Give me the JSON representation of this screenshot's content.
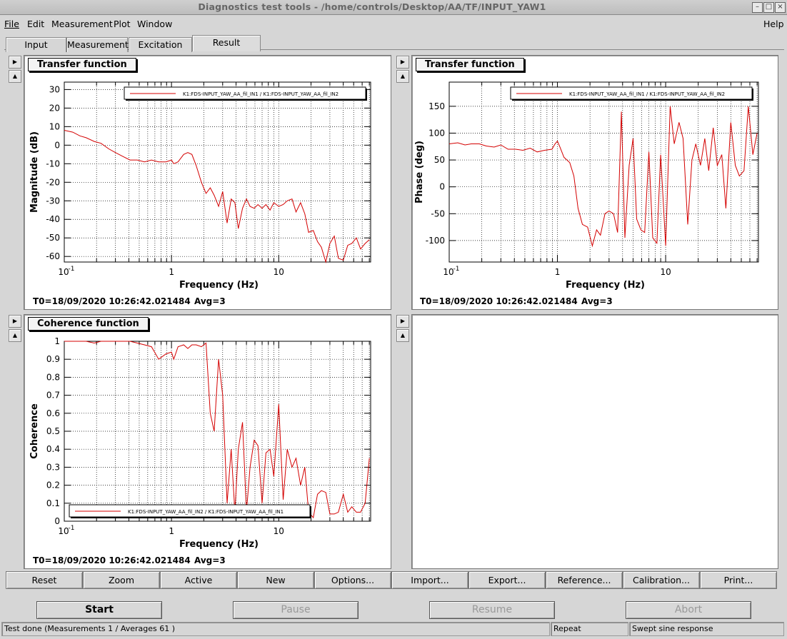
{
  "window": {
    "title": "Diagnostics test tools - /home/controls/Desktop/AA/TF/INPUT_YAW1"
  },
  "menu": {
    "file": "File",
    "edit": "Edit",
    "measurement": "Measurement",
    "plot": "Plot",
    "window": "Window",
    "help": "Help"
  },
  "tabs": [
    "Input",
    "Measurement",
    "Excitation",
    "Result"
  ],
  "active_tab": "Result",
  "plots": {
    "tf_mag": {
      "title": "Transfer function",
      "t0": "T0=18/09/2020 10:26:42.021484",
      "avg": "Avg=3",
      "legend": "K1:FDS-INPUT_YAW_AA_fil_IN1 / K1:FDS-INPUT_YAW_AA_fil_IN2"
    },
    "tf_phase": {
      "title": "Transfer function",
      "t0": "T0=18/09/2020 10:26:42.021484",
      "avg": "Avg=3",
      "legend": "K1:FDS-INPUT_YAW_AA_fil_IN1 / K1:FDS-INPUT_YAW_AA_fil_IN2"
    },
    "coh": {
      "title": "Coherence function",
      "t0": "T0=18/09/2020 10:26:42.021484",
      "avg": "Avg=3",
      "legend": "K1:FDS-INPUT_YAW_AA_fil_IN2 / K1:FDS-INPUT_YAW_AA_fil_IN1"
    }
  },
  "toolbar": [
    "Reset",
    "Zoom",
    "Active",
    "New",
    "Options...",
    "Import...",
    "Export...",
    "Reference...",
    "Calibration...",
    "Print..."
  ],
  "actions": {
    "start": "Start",
    "pause": "Pause",
    "resume": "Resume",
    "abort": "Abort"
  },
  "status": {
    "message": "Test done (Measurements 1 / Averages 61 )",
    "mode": "Repeat",
    "type": "Swept sine response"
  },
  "colors": {
    "trace": "#d40000",
    "grid": "#000000"
  },
  "chart_data": [
    {
      "id": "tf_mag",
      "type": "line",
      "xscale": "log",
      "xlim": [
        0.1,
        72
      ],
      "ylim": [
        -63,
        34
      ],
      "xlabel": "Frequency (Hz)",
      "ylabel": "Magnitude (dB)",
      "xticklabels": [
        "10^-1",
        "1",
        "10"
      ],
      "yticks": [
        30,
        20,
        10,
        0,
        -10,
        -20,
        -30,
        -40,
        -50,
        -60
      ],
      "grid": true,
      "legend_position": "top-right",
      "series": [
        {
          "name": "K1:FDS-INPUT_YAW_AA_fil_IN1 / K1:FDS-INPUT_YAW_AA_fil_IN2",
          "x": [
            0.1,
            0.12,
            0.14,
            0.16,
            0.19,
            0.22,
            0.26,
            0.3,
            0.35,
            0.41,
            0.48,
            0.56,
            0.65,
            0.76,
            0.89,
            1.0,
            1.05,
            1.15,
            1.3,
            1.42,
            1.55,
            1.7,
            1.9,
            2.1,
            2.3,
            2.5,
            2.75,
            3.0,
            3.3,
            3.6,
            3.9,
            4.2,
            4.6,
            5.0,
            5.4,
            5.9,
            6.4,
            7.0,
            7.6,
            8.3,
            9.0,
            10.0,
            11.0,
            12.0,
            13.3,
            14.5,
            16.0,
            17.5,
            19.0,
            21.0,
            23.0,
            25.0,
            27.5,
            30.0,
            33.0,
            36.0,
            40.0,
            44.0,
            48.0,
            53.0,
            58.0,
            64.0,
            70.0
          ],
          "y": [
            8,
            7,
            5,
            4,
            2,
            1,
            -2,
            -4,
            -6,
            -8,
            -8,
            -9,
            -8,
            -9,
            -9,
            -8,
            -10,
            -9,
            -5,
            -4,
            -5,
            -11,
            -20,
            -26,
            -23,
            -27,
            -33,
            -25,
            -42,
            -29,
            -31,
            -45,
            -34,
            -29,
            -33,
            -34,
            -32,
            -34,
            -32,
            -35,
            -31,
            -33,
            -32,
            -30,
            -29,
            -36,
            -31,
            -37,
            -47,
            -46,
            -52,
            -55,
            -64,
            -53,
            -49,
            -61,
            -62,
            -54,
            -53,
            -50,
            -56,
            -53,
            -51
          ]
        }
      ]
    },
    {
      "id": "tf_phase",
      "type": "line",
      "xscale": "log",
      "xlim": [
        0.1,
        72
      ],
      "ylim": [
        -140,
        195
      ],
      "xlabel": "Frequency (Hz)",
      "ylabel": "Phase (deg)",
      "xticklabels": [
        "10^-1",
        "1",
        "10"
      ],
      "yticks": [
        150,
        100,
        50,
        0,
        -50,
        -100
      ],
      "grid": true,
      "legend_position": "top-right",
      "series": [
        {
          "name": "K1:FDS-INPUT_YAW_AA_fil_IN1 / K1:FDS-INPUT_YAW_AA_fil_IN2",
          "x": [
            0.1,
            0.12,
            0.14,
            0.16,
            0.19,
            0.22,
            0.26,
            0.3,
            0.35,
            0.41,
            0.48,
            0.56,
            0.65,
            0.76,
            0.89,
            0.95,
            1.0,
            1.05,
            1.15,
            1.3,
            1.42,
            1.55,
            1.7,
            1.9,
            2.1,
            2.3,
            2.5,
            2.75,
            3.0,
            3.3,
            3.6,
            3.9,
            4.2,
            4.6,
            5.0,
            5.4,
            5.9,
            6.4,
            7.0,
            7.6,
            8.3,
            9.0,
            10.0,
            11.0,
            12.0,
            13.3,
            14.5,
            16.0,
            17.5,
            19.0,
            21.0,
            23.0,
            25.0,
            27.5,
            30.0,
            33.0,
            36.0,
            40.0,
            44.0,
            48.0,
            53.0,
            58.0,
            64.0,
            70.0
          ],
          "y": [
            80,
            82,
            78,
            80,
            80,
            76,
            74,
            78,
            70,
            70,
            68,
            72,
            65,
            68,
            70,
            80,
            85,
            75,
            55,
            45,
            20,
            -40,
            -70,
            -75,
            -110,
            -80,
            -90,
            -50,
            -45,
            -50,
            -85,
            140,
            -95,
            40,
            90,
            -60,
            -80,
            -85,
            65,
            -95,
            -105,
            60,
            -110,
            150,
            80,
            120,
            90,
            -70,
            50,
            80,
            40,
            90,
            30,
            110,
            40,
            60,
            -40,
            120,
            40,
            20,
            30,
            150,
            60,
            100
          ]
        }
      ]
    },
    {
      "id": "coh",
      "type": "line",
      "xscale": "log",
      "xlim": [
        0.1,
        72
      ],
      "ylim": [
        0,
        1
      ],
      "xlabel": "Frequency (Hz)",
      "ylabel": "Coherence",
      "xticklabels": [
        "10^-1",
        "1",
        "10"
      ],
      "yticks": [
        1,
        0.9,
        0.8,
        0.7,
        0.6,
        0.5,
        0.4,
        0.3,
        0.2,
        0.1,
        0
      ],
      "grid": true,
      "legend_position": "bottom-left",
      "series": [
        {
          "name": "K1:FDS-INPUT_YAW_AA_fil_IN2 / K1:FDS-INPUT_YAW_AA_fil_IN1",
          "x": [
            0.1,
            0.12,
            0.14,
            0.16,
            0.19,
            0.22,
            0.26,
            0.3,
            0.35,
            0.41,
            0.48,
            0.56,
            0.65,
            0.76,
            0.89,
            1.0,
            1.05,
            1.15,
            1.3,
            1.42,
            1.55,
            1.7,
            1.9,
            2.1,
            2.3,
            2.5,
            2.75,
            3.0,
            3.3,
            3.6,
            3.9,
            4.2,
            4.6,
            5.0,
            5.4,
            5.9,
            6.4,
            7.0,
            7.6,
            8.3,
            9.0,
            10.0,
            11.0,
            12.0,
            13.3,
            14.5,
            16.0,
            17.5,
            19.0,
            21.0,
            23.0,
            25.0,
            27.5,
            30.0,
            33.0,
            36.0,
            40.0,
            44.0,
            48.0,
            53.0,
            58.0,
            64.0,
            70.0
          ],
          "y": [
            1,
            1,
            1,
            1,
            0.99,
            1,
            1,
            1,
            1,
            1,
            0.99,
            0.98,
            0.97,
            0.9,
            0.93,
            0.94,
            0.9,
            0.97,
            0.98,
            0.96,
            0.98,
            0.98,
            0.97,
            0.99,
            0.6,
            0.5,
            0.9,
            0.7,
            0.1,
            0.4,
            0.05,
            0.4,
            0.55,
            0.05,
            0.3,
            0.45,
            0.42,
            0.1,
            0.38,
            0.4,
            0.25,
            0.65,
            0.12,
            0.4,
            0.3,
            0.35,
            0.2,
            0.3,
            0.05,
            0.02,
            0.15,
            0.17,
            0.16,
            0.04,
            0.04,
            0.05,
            0.15,
            0.05,
            0.08,
            0.05,
            0.05,
            0.1,
            0.35
          ]
        }
      ]
    }
  ]
}
